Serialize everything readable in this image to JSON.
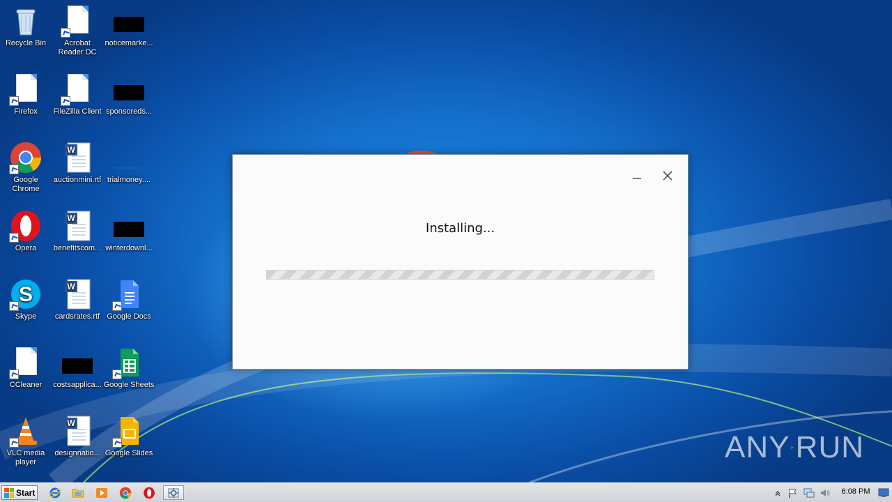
{
  "desktop": {
    "icons": [
      {
        "label": "Recycle Bin"
      },
      {
        "label": "Acrobat Reader DC"
      },
      {
        "label": "noticemarke..."
      },
      {
        "label": "Firefox"
      },
      {
        "label": "FileZilla Client"
      },
      {
        "label": "sponsoreds..."
      },
      {
        "label": "Google Chrome"
      },
      {
        "label": "auctionmini.rtf"
      },
      {
        "label": "trialmoney...."
      },
      {
        "label": "Opera"
      },
      {
        "label": "benefitscom..."
      },
      {
        "label": "winterdownl..."
      },
      {
        "label": "Skype"
      },
      {
        "label": "cardsrates.rtf"
      },
      {
        "label": "Google Docs"
      },
      {
        "label": "CCleaner"
      },
      {
        "label": "costsapplica..."
      },
      {
        "label": "Google Sheets"
      },
      {
        "label": "VLC media player"
      },
      {
        "label": "designnatio..."
      },
      {
        "label": "Google Slides"
      }
    ],
    "watermark": {
      "left": "ANY",
      "right": "RUN"
    }
  },
  "installer": {
    "status_text": "Installing...",
    "progress_fraction": 0.0
  },
  "taskbar": {
    "start_label": "Start",
    "pinned": [
      "internet-explorer-icon",
      "explorer-icon",
      "media-player-icon",
      "chrome-icon",
      "opera-icon",
      "installer-icon"
    ],
    "clock": "6:08 PM"
  },
  "colors": {
    "desktop_blue": "#1470cc",
    "taskbar": "#d6d9de",
    "window_bg": "#fbfbfb"
  }
}
